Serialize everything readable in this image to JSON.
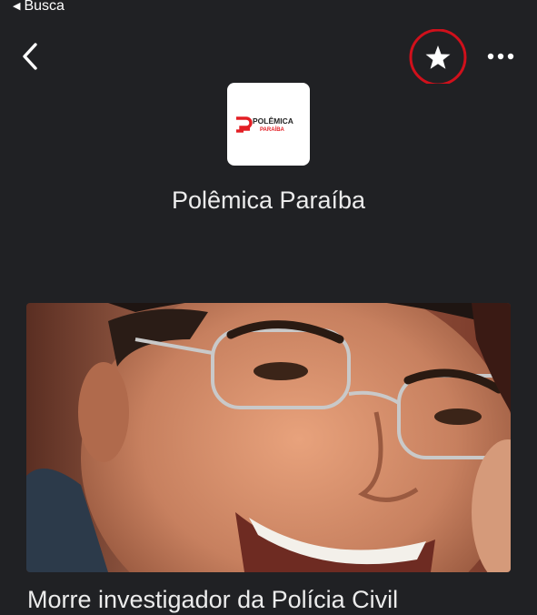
{
  "status_bar": {
    "back_app_label": "Busca"
  },
  "header": {
    "back_icon": "chevron-left-icon",
    "follow_icon": "star-icon",
    "more_icon": "more-horizontal-icon",
    "follow_highlight_color": "#d0101b"
  },
  "publisher": {
    "name": "Polêmica Paraíba",
    "logo_text_top": "POLÊMICA",
    "logo_text_bottom": "PARAÍBA",
    "logo_color": "#e31e24"
  },
  "articles": [
    {
      "title": "Morre investigador da Polícia Civil",
      "image": "man-smiling-with-glasses-photo"
    }
  ],
  "colors": {
    "background": "#202124",
    "text": "#ececec"
  }
}
